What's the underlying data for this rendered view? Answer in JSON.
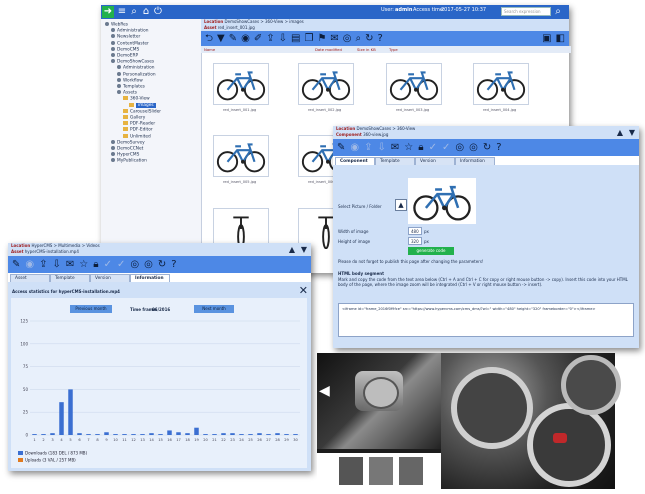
{
  "main_window": {
    "topbar": {
      "user_label": "User:",
      "user_value": "admin",
      "access_label": "Access time:",
      "access_value": "2017-05-27 10:37",
      "search_placeholder": "Search expression"
    },
    "sidebar": {
      "items": [
        {
          "label": "WebRes",
          "level": 0
        },
        {
          "label": "Administration",
          "level": 1
        },
        {
          "label": "Newsletter",
          "level": 1
        },
        {
          "label": "ContentMaster",
          "level": 1
        },
        {
          "label": "DemoCMS",
          "level": 1
        },
        {
          "label": "DemoERP",
          "level": 1
        },
        {
          "label": "DemoShowCases",
          "level": 1
        },
        {
          "label": "Administration",
          "level": 2
        },
        {
          "label": "Personalization",
          "level": 2
        },
        {
          "label": "Workflow",
          "level": 2
        },
        {
          "label": "Templates",
          "level": 2
        },
        {
          "label": "Assets",
          "level": 2
        },
        {
          "label": "360-View",
          "level": 3
        },
        {
          "label": "images",
          "level": 4
        },
        {
          "label": "CarouselSlider",
          "level": 3
        },
        {
          "label": "Gallery",
          "level": 3
        },
        {
          "label": "PDF-Reader",
          "level": 3
        },
        {
          "label": "PDF-Editor",
          "level": 3
        },
        {
          "label": "Unlimited",
          "level": 3
        },
        {
          "label": "DemoSurvey",
          "level": 1
        },
        {
          "label": "DemoCCNet",
          "level": 1
        },
        {
          "label": "HyperCMS",
          "level": 1
        },
        {
          "label": "MyPublication",
          "level": 1
        }
      ]
    },
    "location": {
      "label": "Location",
      "path": "DemoShowCases > 360-View > images",
      "asset_label": "Asset",
      "asset_value": "red_insert_001.jpg"
    },
    "columns": [
      "Name",
      "Date modified",
      "Size in KB",
      "Type"
    ],
    "thumbs": [
      "red_insert_001.jpg",
      "red_insert_002.jpg",
      "red_insert_003.jpg",
      "red_insert_004.jpg",
      "red_insert_005.jpg",
      "red_insert_006.jpg"
    ]
  },
  "component_window": {
    "location_label": "Location",
    "location_path": "DemoShowCases > 360-View",
    "component_label": "Component",
    "component_value": "360-view.jpg",
    "tabs": [
      "Component",
      "Template",
      "Version",
      "Information"
    ],
    "select_label": "Select Picture / Folder",
    "width_label": "Width of image",
    "width_value": "480",
    "height_label": "Height of image",
    "height_value": "320",
    "unit": "px",
    "generate_button": "generate code",
    "notice": "Please do not forget to publish this page after changing the parameters!",
    "html_heading": "HTML body segment",
    "html_desc": "Mark and copy the code from the text area below (Ctrl + A and Ctrl + C for copy or right mouse button -> copy). Insert this code into your HTML body of the page, where the image zoom will be integrated (Ctrl + V or right mouse button -> insert).",
    "code": "<iframe id=\"frame_2016f0f9fce\" src=\"https://www.hypercms.com/cms_dms/?wl=\" width=\"480\" height=\"320\" frameborder=\"0\"></iframe>"
  },
  "stats_window": {
    "location_label": "Location",
    "location_path": "HyperCMS > Multimedia > Videos",
    "asset_label": "Asset",
    "asset_value": "hyperCMS-installation.mp4",
    "tabs": [
      "Asset",
      "Template",
      "Version",
      "Information"
    ],
    "title": "Access statistics for hyperCMS-installation.mp4",
    "prev_button": "Previous month",
    "time_frame_label": "Time frame:",
    "time_frame_value": "06/2016",
    "next_button": "Next month",
    "legend": [
      {
        "label": "Downloads (183 DEL / 873 MB)",
        "color": "#3b6fd1"
      },
      {
        "label": "Uploads (3 VAL / 257 MB)",
        "color": "#e07a1f"
      }
    ]
  },
  "chart_data": {
    "type": "bar",
    "categories": [
      "1",
      "2",
      "3",
      "4",
      "5",
      "6",
      "7",
      "8",
      "9",
      "10",
      "11",
      "12",
      "13",
      "14",
      "15",
      "16",
      "17",
      "18",
      "19",
      "20",
      "21",
      "22",
      "23",
      "24",
      "25",
      "26",
      "27",
      "28",
      "29",
      "30"
    ],
    "series": [
      {
        "name": "Downloads (183 DEL / 873 MB)",
        "values": [
          1,
          1,
          2,
          36,
          50,
          2,
          1,
          1,
          3,
          1,
          1,
          1,
          1,
          2,
          1,
          5,
          3,
          2,
          8,
          1,
          1,
          2,
          2,
          1,
          1,
          2,
          1,
          2,
          1,
          1
        ]
      },
      {
        "name": "Uploads (3 VAL / 257 MB)",
        "values": [
          0,
          0,
          0,
          0,
          0,
          0,
          0,
          0,
          0,
          0,
          0,
          0,
          0,
          0,
          0,
          0,
          0,
          0,
          0,
          0,
          0,
          0,
          0,
          0,
          0,
          0,
          0,
          0,
          0,
          0
        ]
      }
    ],
    "yticks": [
      "0",
      "25",
      "50",
      "75",
      "100",
      "125"
    ],
    "ylim": [
      0,
      125
    ],
    "grid": true,
    "legend_position": "bottom-left"
  },
  "colors": {
    "accent": "#2a66c8",
    "toolbar": "#4d88e6",
    "panel": "#cfe0f7",
    "download": "#3b6fd1"
  }
}
